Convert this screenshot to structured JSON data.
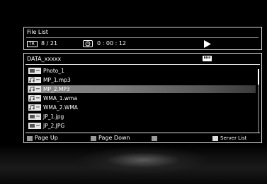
{
  "header": {
    "title": "File List",
    "track_badge": "TR",
    "track": "8 / 21",
    "time": "0 : 00 : 12"
  },
  "folder": {
    "name": "DATA_xxxxx"
  },
  "files": [
    {
      "name": "Photo_1",
      "kind": "photo",
      "selected": false
    },
    {
      "name": "MP_1.mp3",
      "kind": "audio",
      "selected": false
    },
    {
      "name": "MP_2.MP3",
      "kind": "audio",
      "selected": true
    },
    {
      "name": "WMA_1.wma",
      "kind": "audio",
      "selected": false
    },
    {
      "name": "WMA_2.WMA",
      "kind": "audio",
      "selected": false
    },
    {
      "name": "JP_1.jpg",
      "kind": "photo",
      "selected": false
    },
    {
      "name": "JP_2.JPG",
      "kind": "photo",
      "selected": false
    }
  ],
  "footer": {
    "page_up": "Page Up",
    "page_down": "Page Down",
    "server_list": "Server List"
  },
  "colors": {
    "button_swatch": "#9a9a9a",
    "server_swatch": "#dcdcdc",
    "selected_row": "#8a8a8a",
    "frame_border": "#d8d8d8"
  },
  "icons": [
    "clock-icon",
    "play-icon",
    "card-icon",
    "audio-file-icon",
    "photo-file-icon"
  ]
}
